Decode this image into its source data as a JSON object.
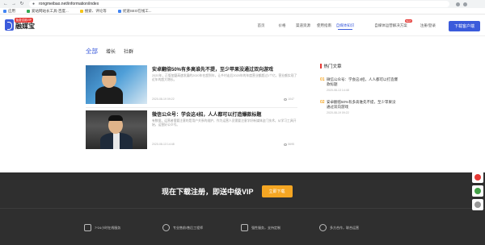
{
  "browser": {
    "url": "rongmeibao.net/information/index",
    "bookmarks": [
      "应用",
      "爱站网站长工具-百度...",
      "搜索、评论等",
      "优速SEO在线工..."
    ]
  },
  "header": {
    "logo_text": "融媒宝",
    "logo_badge": "免费试用VIP",
    "nav": [
      "首页",
      "价格",
      "渠道资源",
      "使用指南",
      "自媒体知识"
    ],
    "active_nav_index": 4,
    "right_links": [
      "自媒体运营解决方案",
      "注册/登录"
    ],
    "hot_badge": "NEW",
    "download_label": "下载客户端"
  },
  "tabs": [
    "全部",
    "增长",
    "社群"
  ],
  "articles": [
    {
      "title": "安卓翻倍50%有多高谁先不提，至少苹果没通过双向游戏",
      "desc": "2020年，正版加盟高速发展的2020年在超到年，让乡村走后2020年的年度营业额超过1个亿，营业额实现了近年的超大增长。",
      "date": "2020-08-19 09:22",
      "views": "1047"
    },
    {
      "title": "微信公众号：学会这4招，人人都可以打造爆款标题",
      "desc": "有数据，运营者需要注意的是用户关系的维护，作为运营人员需要注意学好新媒体这门技术，从学习工具开始，运营好公众号。",
      "date": "2020-08-13 14:48",
      "views": "5695"
    }
  ],
  "sidebar": {
    "title": "热门文章",
    "items": [
      {
        "num": "01",
        "text": "微信公众号：学会这4招，人人都可以打造爆款标题",
        "date": "2020-08-13 14:48"
      },
      {
        "num": "02",
        "text": "安卓翻倍50%有多高谁先不提，至少苹果没通过双向游戏",
        "date": "2020-08-19 09:22"
      }
    ]
  },
  "footer": {
    "cta_text": "现在下载注册，即送中级VIP",
    "cta_button": "立即下载",
    "features": [
      "7*24小时在线服务",
      "专业售前/售后工程师",
      "强性服务，支持定制",
      "多方合作，联合运营"
    ]
  },
  "colors": {
    "accent": "#3b5bdb",
    "hot": "#e53935",
    "cta": "#f5a623",
    "footer_bg": "#2f2f2f"
  }
}
